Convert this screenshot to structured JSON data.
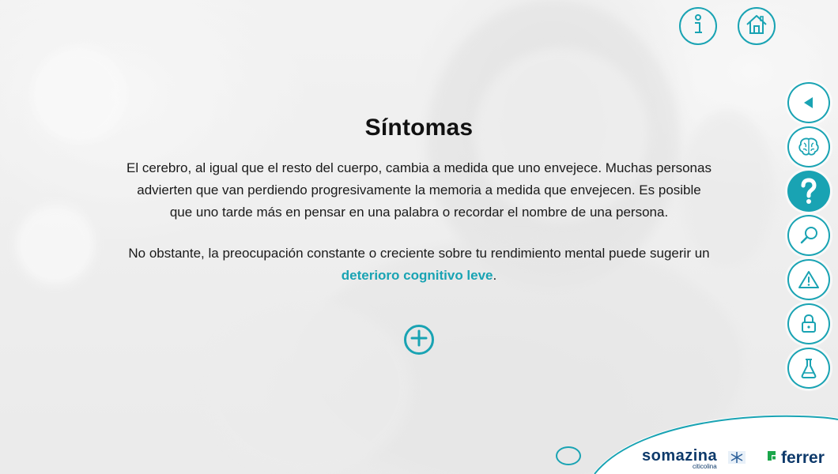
{
  "header": {
    "info_icon": "info-icon",
    "home_icon": "home-icon"
  },
  "sidebar": {
    "items": [
      {
        "icon": "back-arrow-icon",
        "active": false
      },
      {
        "icon": "brain-icon",
        "active": false
      },
      {
        "icon": "question-icon",
        "active": true
      },
      {
        "icon": "magnifier-icon",
        "active": false
      },
      {
        "icon": "warning-icon",
        "active": false
      },
      {
        "icon": "lock-icon",
        "active": false
      },
      {
        "icon": "flask-icon",
        "active": false
      }
    ]
  },
  "main": {
    "title": "Síntomas",
    "paragraph1": "El cerebro, al igual que el resto del cuerpo, cambia a medida que uno envejece. Muchas personas advierten que van perdiendo progresivamente la memoria a medida que envejecen. Es posible que uno tarde más en pensar en una palabra o recordar el nombre de una persona.",
    "paragraph2_prefix": "No obstante, la preocupación constante o creciente sobre tu rendimiento mental puede sugerir un ",
    "paragraph2_highlight": "deterioro cognitivo leve",
    "paragraph2_suffix": ".",
    "expand_icon": "plus-circle-icon"
  },
  "footer": {
    "brand1": "somazina",
    "brand1_sub": "citicolina",
    "brand2": "ferrer"
  },
  "colors": {
    "accent": "#19a3b3",
    "brand_navy": "#0e3a6b"
  }
}
